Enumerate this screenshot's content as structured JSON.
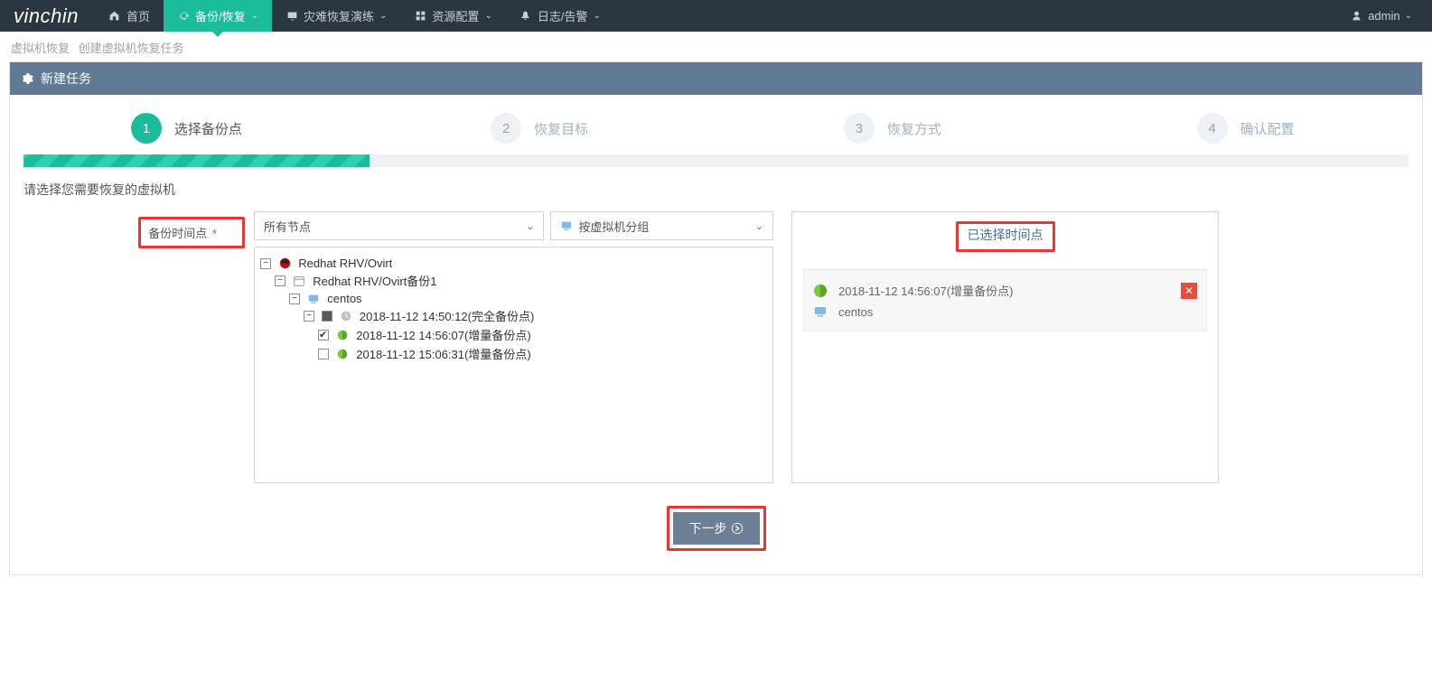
{
  "brand": "vinchin",
  "nav": {
    "home": "首页",
    "backup": "备份/恢复",
    "drill": "灾难恢复演练",
    "resource": "资源配置",
    "log": "日志/告警"
  },
  "user": {
    "name": "admin"
  },
  "breadcrumb": {
    "a": "虚拟机恢复",
    "b": "创建虚拟机恢复任务"
  },
  "panel": {
    "title": "新建任务"
  },
  "wizard": {
    "step1": {
      "num": "1",
      "label": "选择备份点"
    },
    "step2": {
      "num": "2",
      "label": "恢复目标"
    },
    "step3": {
      "num": "3",
      "label": "恢复方式"
    },
    "step4": {
      "num": "4",
      "label": "确认配置"
    }
  },
  "section_title": "请选择您需要恢复的虚拟机",
  "form": {
    "label": "备份时间点",
    "select_node": "所有节点",
    "select_group": "按虚拟机分组"
  },
  "tree": {
    "root": "Redhat RHV/Ovirt",
    "job": "Redhat RHV/Ovirt备份1",
    "vm": "centos",
    "bp_full": "2018-11-12 14:50:12(完全备份点)",
    "bp_inc1": "2018-11-12 14:56:07(增量备份点)",
    "bp_inc2": "2018-11-12 15:06:31(增量备份点)"
  },
  "side": {
    "header": "已选择时间点",
    "time": "2018-11-12 14:56:07(增量备份点)",
    "vm": "centos"
  },
  "buttons": {
    "next": "下一步"
  }
}
